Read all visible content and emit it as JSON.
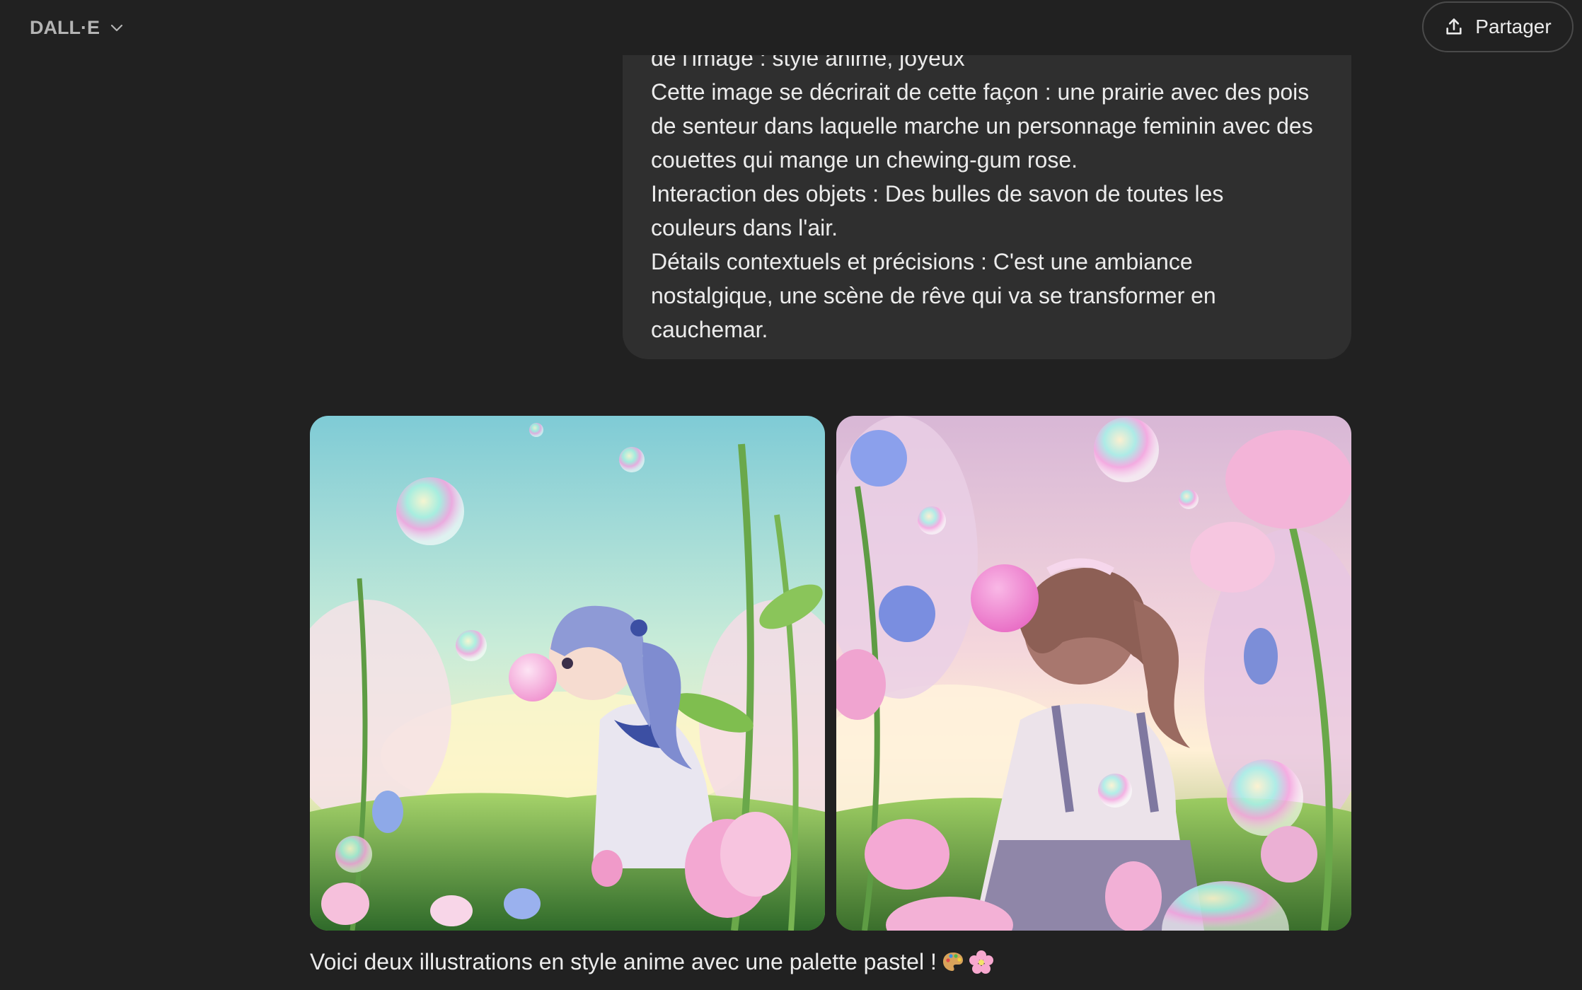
{
  "header": {
    "model_name": "DALL·E",
    "share_label": "Partager"
  },
  "user_message": {
    "partial_top_line": "de l'image : style anime, joyeux",
    "lines": [
      "Cette image se décrirait de cette façon : une prairie avec des pois",
      "de senteur dans laquelle marche un personnage feminin avec des",
      "couettes qui mange un chewing-gum rose.",
      "Interaction des objets : Des bulles de savon de toutes les",
      "couleurs dans l'air.",
      "Détails contextuels et précisions : C'est une ambiance",
      "nostalgique, une scène de rêve qui va se transformer en",
      "cauchemar."
    ]
  },
  "assistant": {
    "caption": "Voici deux illustrations en style anime avec une palette pastel !",
    "caption_icons": [
      "palette-icon",
      "cherry-blossom-icon"
    ]
  },
  "colors": {
    "background": "#212121",
    "bubble": "#2f2f2f",
    "text": "#ececec",
    "muted": "#b4b4b4"
  }
}
